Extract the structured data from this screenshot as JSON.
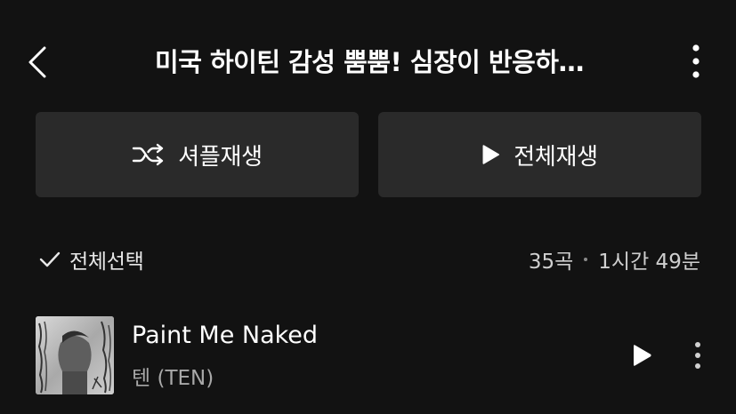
{
  "header": {
    "title": "미국 하이틴 감성 뿜뿜! 심장이 반응하…",
    "back_icon": "chevron-left-icon",
    "more_icon": "more-vertical-icon"
  },
  "actions": {
    "shuffle_label": "셔플재생",
    "shuffle_icon": "shuffle-icon",
    "play_all_label": "전체재생",
    "play_all_icon": "play-icon"
  },
  "list_header": {
    "select_all_label": "전체선택",
    "select_all_icon": "check-icon",
    "track_count": "35곡",
    "total_duration": "1시간 49분"
  },
  "tracks": [
    {
      "title": "Paint Me Naked",
      "artist": "텐 (TEN)",
      "play_icon": "play-icon",
      "more_icon": "more-vertical-icon"
    }
  ],
  "colors": {
    "background": "#121212",
    "button_background": "#2a2a2a",
    "text_primary": "#ffffff",
    "text_secondary": "#a8a8a8"
  }
}
